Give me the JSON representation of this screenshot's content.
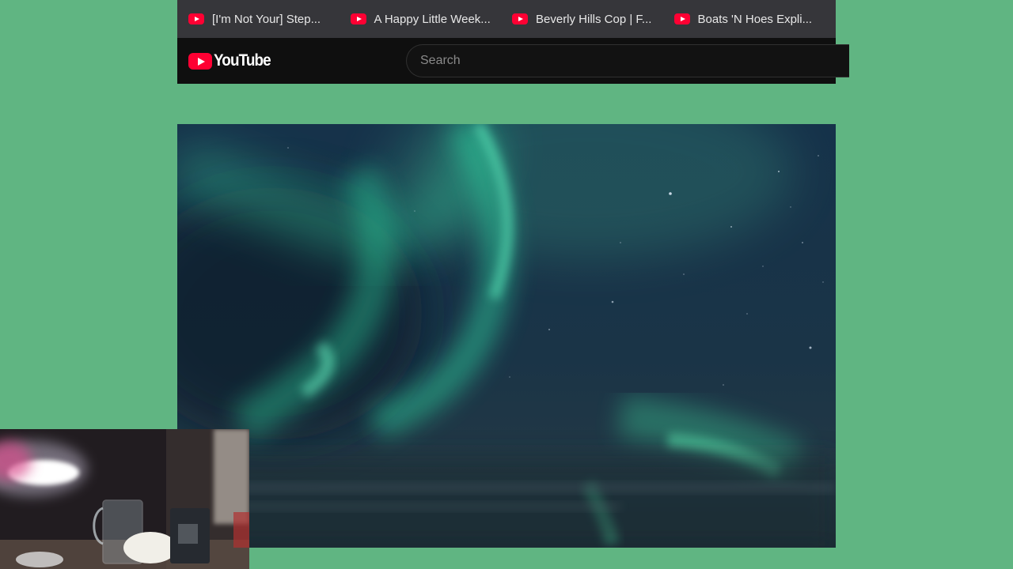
{
  "browser": {
    "tabs": [
      {
        "title": "[I'm Not Your] Step..."
      },
      {
        "title": "A Happy Little Week..."
      },
      {
        "title": "Beverly Hills Cop | F..."
      },
      {
        "title": "Boats 'N Hoes Expli..."
      }
    ]
  },
  "youtube": {
    "logo_text": "YouTube",
    "search": {
      "placeholder": "Search",
      "value": ""
    }
  },
  "colors": {
    "background": "#60b582",
    "tabs_bar": "#36363a",
    "header": "#0f0f0f",
    "brand_red": "#ff0033"
  },
  "video": {
    "scene": "aurora-night-sky"
  },
  "overlay": {
    "type": "webcam-feed"
  }
}
